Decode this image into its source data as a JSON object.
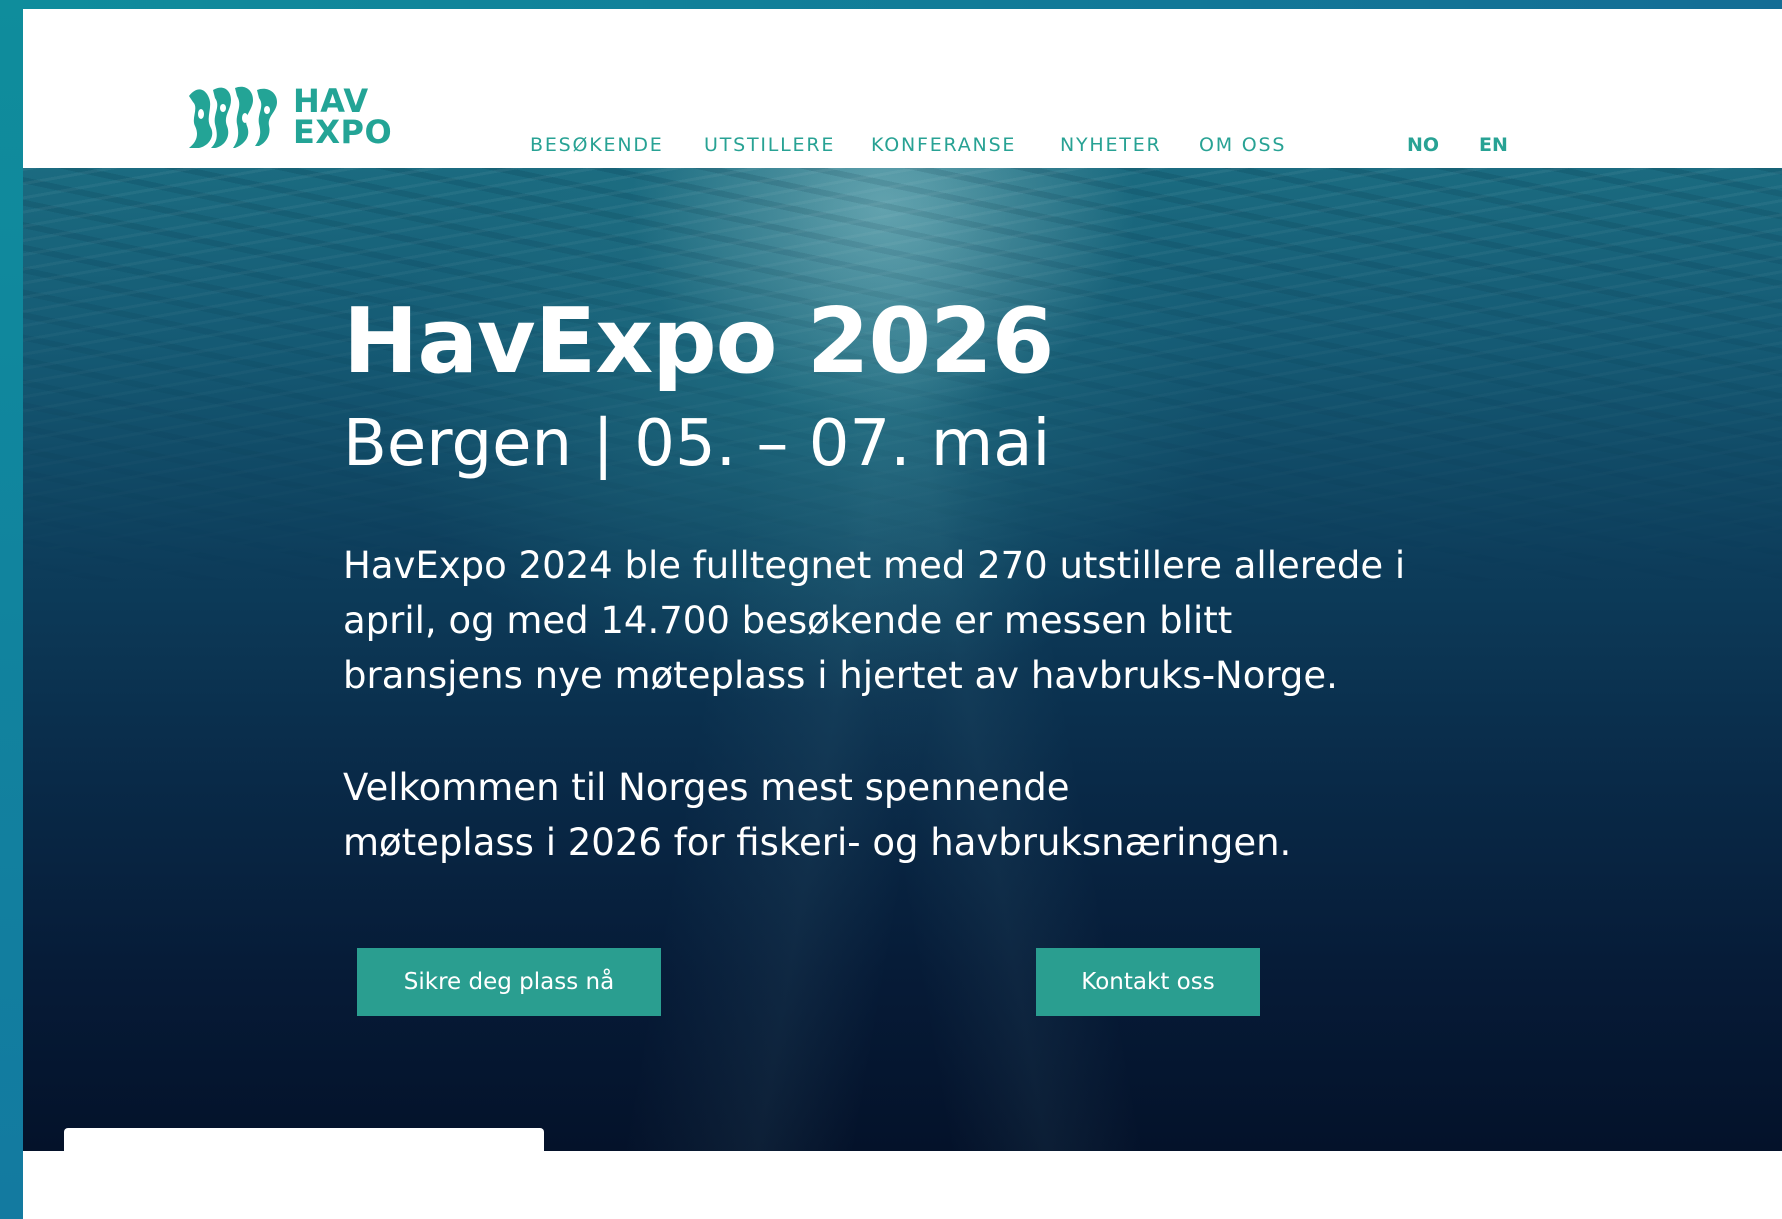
{
  "brand": {
    "logo_line1": "HAV",
    "logo_line2": "EXPO",
    "color": "#23a496"
  },
  "nav": {
    "items": [
      {
        "label": "BESØKENDE"
      },
      {
        "label": "UTSTILLERE"
      },
      {
        "label": "KONFERANSE"
      },
      {
        "label": "NYHETER"
      },
      {
        "label": "OM OSS"
      }
    ]
  },
  "lang": {
    "no": "NO",
    "en": "EN"
  },
  "hero": {
    "title": "HavExpo 2026",
    "subtitle": "Bergen | 05. – 07. mai",
    "paragraph1_lines": [
      "HavExpo 2024 ble fulltegnet med 270 utstillere allerede i",
      "april, og med 14.700 besøkende er messen blitt",
      "bransjens nye møteplass i hjertet av havbruks-Norge."
    ],
    "paragraph2_lines": [
      "Velkommen til Norges mest spennende",
      "møteplass i 2026 for fiskeri- og havbruksnæringen."
    ],
    "primary_button": "Sikre deg plass nå",
    "secondary_button": "Kontakt oss",
    "button_color": "#2a9e90"
  }
}
